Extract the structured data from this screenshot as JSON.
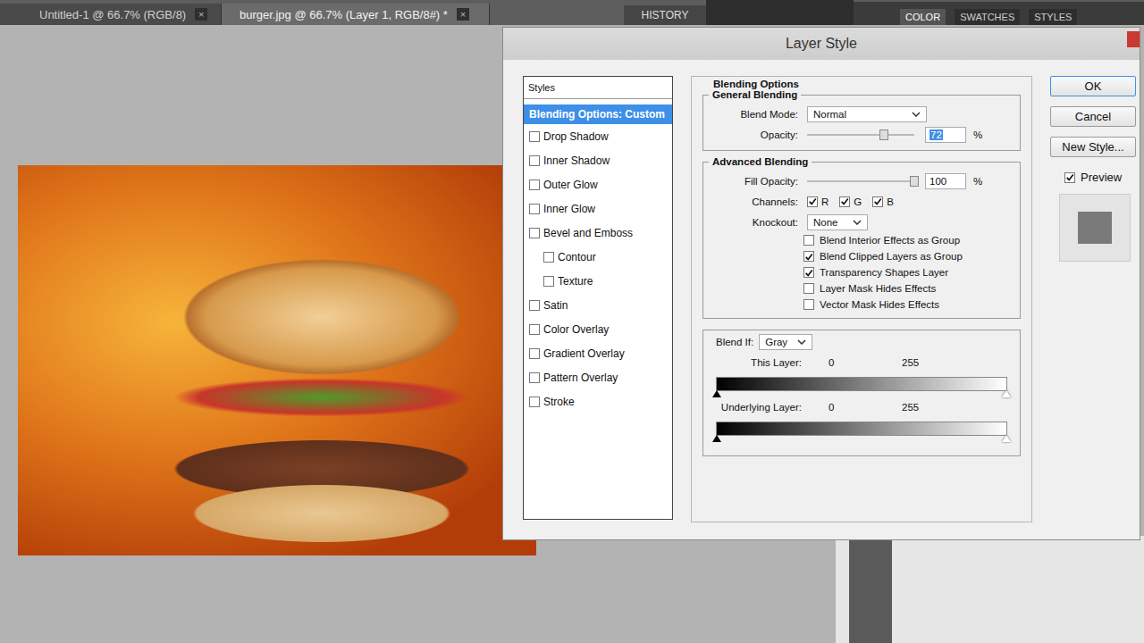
{
  "app_tabs": [
    {
      "label": "Untitled-1 @ 66.7% (RGB/8)",
      "close": "×",
      "selected": false
    },
    {
      "label": "burger.jpg @ 66.7% (Layer 1, RGB/8#) *",
      "close": "×",
      "selected": true
    }
  ],
  "history_tab": {
    "label": "HISTORY",
    "selected": true
  },
  "panel_tabs": [
    {
      "label": "COLOR",
      "selected": true
    },
    {
      "label": "SWATCHES",
      "selected": false
    },
    {
      "label": "STYLES",
      "selected": false
    }
  ],
  "dialog": {
    "title": "Layer Style"
  },
  "styles": {
    "header": "Styles",
    "items": [
      {
        "label": "Blending Options: Custom",
        "kind": "option",
        "selected": true
      },
      {
        "label": "Drop Shadow",
        "kind": "effect",
        "checked": false,
        "selected": false
      },
      {
        "label": "Inner Shadow",
        "kind": "effect",
        "checked": false,
        "selected": false
      },
      {
        "label": "Outer Glow",
        "kind": "effect",
        "checked": false,
        "selected": false
      },
      {
        "label": "Inner Glow",
        "kind": "effect",
        "checked": false,
        "selected": false
      },
      {
        "label": "Bevel and Emboss",
        "kind": "effect",
        "checked": false,
        "selected": false
      },
      {
        "label": "Contour",
        "kind": "subeffect",
        "checked": false,
        "selected": false
      },
      {
        "label": "Texture",
        "kind": "subeffect",
        "checked": false,
        "selected": false
      },
      {
        "label": "Satin",
        "kind": "effect",
        "checked": false,
        "selected": false
      },
      {
        "label": "Color Overlay",
        "kind": "effect",
        "checked": false,
        "selected": false
      },
      {
        "label": "Gradient Overlay",
        "kind": "effect",
        "checked": false,
        "selected": false
      },
      {
        "label": "Pattern Overlay",
        "kind": "effect",
        "checked": false,
        "selected": false
      },
      {
        "label": "Stroke",
        "kind": "effect",
        "checked": false,
        "selected": false
      }
    ]
  },
  "blending": {
    "title": "Blending Options",
    "general": {
      "title": "General Blending",
      "blend_mode": {
        "label": "Blend Mode:",
        "value": "Normal"
      },
      "opacity": {
        "label": "Opacity:",
        "value": "72",
        "unit": "%",
        "level": 0.72,
        "selected": true
      }
    },
    "advanced": {
      "title": "Advanced Blending",
      "fill_opacity": {
        "label": "Fill Opacity:",
        "value": "100",
        "unit": "%",
        "level": 1,
        "selected": false
      },
      "channels": {
        "label": "Channels:",
        "items": [
          {
            "label": "R",
            "checked": true
          },
          {
            "label": "G",
            "checked": true
          },
          {
            "label": "B",
            "checked": true
          }
        ]
      },
      "knockout": {
        "label": "Knockout:",
        "value": "None"
      },
      "options": [
        {
          "label": "Blend Interior Effects as Group",
          "checked": false
        },
        {
          "label": "Blend Clipped Layers as Group",
          "checked": true
        },
        {
          "label": "Transparency Shapes Layer",
          "checked": true
        },
        {
          "label": "Layer Mask Hides Effects",
          "checked": false
        },
        {
          "label": "Vector Mask Hides Effects",
          "checked": false
        }
      ]
    },
    "blend_if": {
      "label": "Blend If:",
      "value": "Gray",
      "sliders": [
        {
          "label": "This Layer:",
          "low": "0",
          "high": "255"
        },
        {
          "label": "Underlying Layer:",
          "low": "0",
          "high": "255"
        }
      ]
    }
  },
  "buttons": [
    {
      "label": "OK",
      "default": true
    },
    {
      "label": "Cancel",
      "default": false
    },
    {
      "label": "New Style...",
      "default": false
    }
  ],
  "preview": {
    "label": "Preview",
    "checked": true
  }
}
